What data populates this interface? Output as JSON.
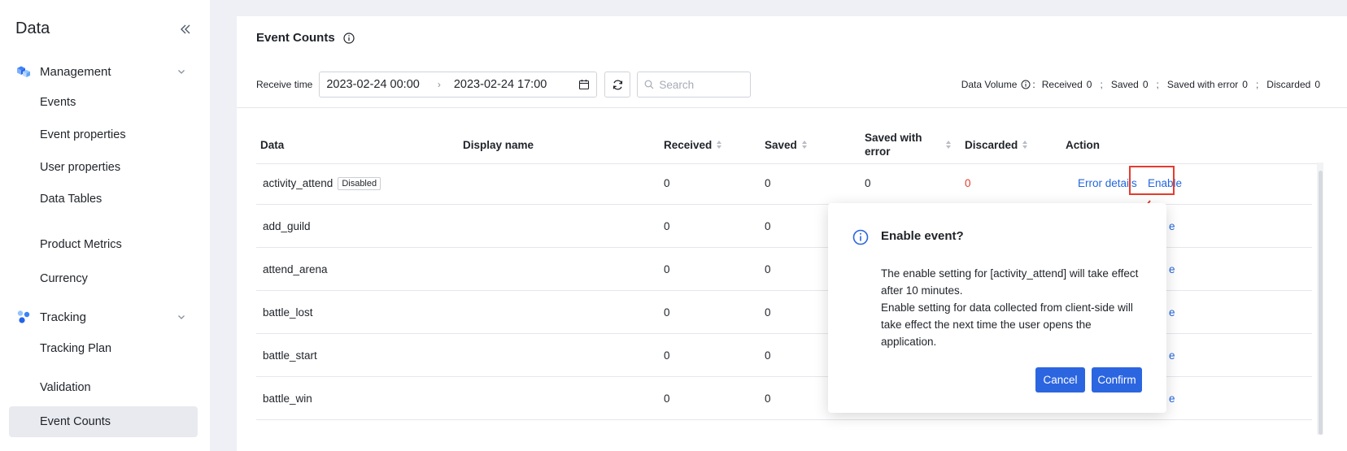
{
  "sidebar": {
    "title": "Data",
    "groups": [
      {
        "label": "Management",
        "icon": "cubes-icon",
        "items": [
          "Events",
          "Event properties",
          "User properties",
          "Data Tables",
          "Product Metrics",
          "Currency"
        ]
      },
      {
        "label": "Tracking",
        "icon": "nodes-icon",
        "items": [
          "Tracking Plan",
          "Validation",
          "Event Counts"
        ]
      }
    ],
    "active_item": "Event Counts"
  },
  "header": {
    "title": "Event Counts",
    "receive_time_label": "Receive time",
    "range_start": "2023-02-24 00:00",
    "range_end": "2023-02-24 17:00",
    "search_placeholder": "Search",
    "volume": {
      "label": "Data Volume",
      "received_label": "Received",
      "received": "0",
      "saved_label": "Saved",
      "saved": "0",
      "saved_error_label": "Saved with error",
      "saved_error": "0",
      "discarded_label": "Discarded",
      "discarded": "0"
    }
  },
  "table": {
    "columns": [
      "Data",
      "Display name",
      "Received",
      "Saved",
      "Saved with error",
      "Discarded",
      "Action"
    ],
    "rows": [
      {
        "data": "activity_attend",
        "tag": "Disabled",
        "received": "0",
        "saved": "0",
        "saved_error": "0",
        "discarded": "0",
        "action_1": "Error details",
        "action_2": "Enable"
      },
      {
        "data": "add_guild",
        "received": "0",
        "saved": "0",
        "action_tail": "e"
      },
      {
        "data": "attend_arena",
        "received": "0",
        "saved": "0",
        "action_tail": "e"
      },
      {
        "data": "battle_lost",
        "received": "0",
        "saved": "0",
        "action_tail": "e"
      },
      {
        "data": "battle_start",
        "received": "0",
        "saved": "0",
        "action_tail": "e"
      },
      {
        "data": "battle_win",
        "received": "0",
        "saved": "0",
        "action_tail": "e"
      }
    ]
  },
  "popover": {
    "title": "Enable event?",
    "line1": "The enable setting for [activity_attend] will take effect after 10 minutes.",
    "line2": "Enable setting for data collected from client-side will take effect the next time the user opens the application.",
    "cancel": "Cancel",
    "confirm": "Confirm"
  },
  "colors": {
    "accent": "#2b65e0",
    "link": "#2266dd",
    "danger": "#e23c2c",
    "highlight": "#e63b2e"
  }
}
